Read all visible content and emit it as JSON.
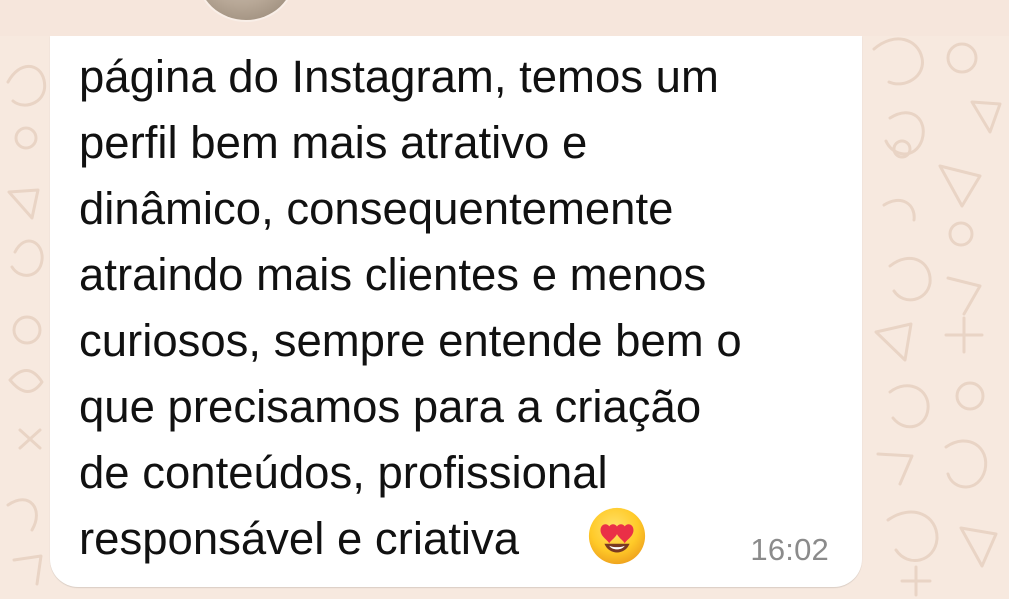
{
  "message": {
    "text": "página do Instagram, temos um\nperfil bem mais atrativo e\ndinâmico, consequentemente\natraindo mais clientes e menos\ncuriosos, sempre entende bem o\nque precisamos para a criação\nde conteúdos, profissional\nresponsável e criativa",
    "emoji": "heart-eyes-emoji",
    "timestamp": "16:02"
  },
  "colors": {
    "wallpaper": "#f7e9df",
    "bubble": "#ffffff",
    "text": "#111111",
    "timestamp": "#8b8b8b",
    "emoji": "#ffca28"
  }
}
